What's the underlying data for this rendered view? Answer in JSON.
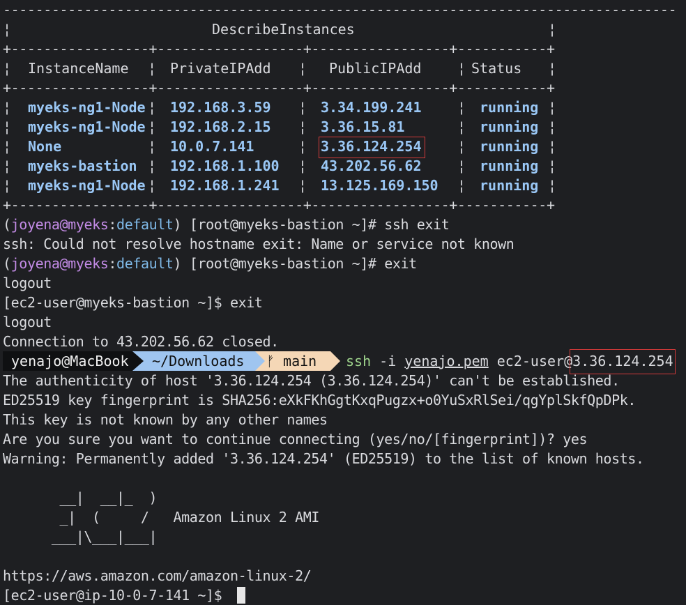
{
  "table": {
    "border_top": "-----------------------------------------------------------------------------------",
    "title": "DescribeInstances",
    "border_mid": "+-----------------+------------------+-----------------+-----------+",
    "headers": [
      "InstanceName",
      "PrivateIPAdd",
      "PublicIPAdd",
      "Status"
    ],
    "rows": [
      {
        "name": "myeks-ng1-Node",
        "private": "192.168.3.59",
        "public": "3.34.199.241",
        "status": "running"
      },
      {
        "name": "myeks-ng1-Node",
        "private": "192.168.2.15",
        "public": "3.36.15.81",
        "status": "running"
      },
      {
        "name": "None",
        "private": "10.0.7.141",
        "public": "3.36.124.254",
        "status": "running"
      },
      {
        "name": "myeks-bastion",
        "private": "192.168.1.100",
        "public": "43.202.56.62",
        "status": "running"
      },
      {
        "name": "myeks-ng1-Node",
        "private": "192.168.1.241",
        "public": "13.125.169.150",
        "status": "running"
      }
    ]
  },
  "prompt1": {
    "user": "joyena",
    "at": "@",
    "host": "myeks",
    "colon": ":",
    "ns": "default",
    "rest": ") [root@myeks-bastion ~]# ssh exit"
  },
  "out1": "ssh: Could not resolve hostname exit: Name or service not known",
  "prompt2": {
    "user": "joyena",
    "at": "@",
    "host": "myeks",
    "colon": ":",
    "ns": "default",
    "rest": ") [root@myeks-bastion ~]# exit"
  },
  "out2": "logout",
  "prompt3": "[ec2-user@myeks-bastion ~]$ exit",
  "out3": "logout",
  "out4": "Connection to 43.202.56.62 closed.",
  "powerline": {
    "user": "yenajo@MacBook",
    "dir": "~/Downloads",
    "branch_icon": "ᚠ",
    "branch": "main",
    "cmd": "ssh",
    "args_pre": " -i ",
    "keyfile": "yenajo.pem",
    "args_post": " ec2-user@",
    "host": "3.36.124.254"
  },
  "ssh_output": [
    "The authenticity of host '3.36.124.254 (3.36.124.254)' can't be established.",
    "ED25519 key fingerprint is SHA256:eXkFKhGgtKxqPugzx+o0YuSxRlSei/qgYplSkfQpDPk.",
    "This key is not known by any other names",
    "Are you sure you want to continue connecting (yes/no/[fingerprint])? yes",
    "Warning: Permanently added '3.36.124.254' (ED25519) to the list of known hosts."
  ],
  "banner": {
    "l1": "       __|  __|_  )",
    "l2": "       _|  (     /   Amazon Linux 2 AMI",
    "l3": "      ___|\\___|___|"
  },
  "url": "https://aws.amazon.com/amazon-linux-2/",
  "final_prompt": "[ec2-user@ip-10-0-7-141 ~]$ ",
  "colors": {
    "highlight_box": "#d43a3a",
    "bold_blue": "#9ac7f5",
    "purple": "#c38be6",
    "green": "#9fd58d"
  }
}
